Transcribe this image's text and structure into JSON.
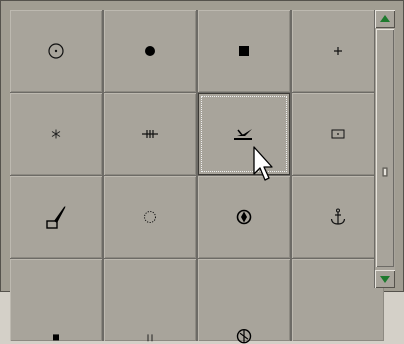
{
  "window": {
    "title": ""
  },
  "symbol_grid": {
    "selected_index": 6,
    "cells": [
      {
        "icon": "circle-dot-icon"
      },
      {
        "icon": "filled-circle-icon"
      },
      {
        "icon": "filled-square-icon"
      },
      {
        "icon": "plus-icon"
      },
      {
        "icon": "asterisk-icon"
      },
      {
        "icon": "railway-track-icon"
      },
      {
        "icon": "plane-wreck-icon"
      },
      {
        "icon": "dotted-rectangle-icon"
      },
      {
        "icon": "paintbrush-icon"
      },
      {
        "icon": "dotted-circle-icon"
      },
      {
        "icon": "circle-marker-icon"
      },
      {
        "icon": "anchor-icon"
      },
      {
        "icon": "partial-icon-a"
      },
      {
        "icon": "partial-icon-b"
      },
      {
        "icon": "partial-icon-c"
      },
      {
        "icon": "empty"
      }
    ]
  },
  "scrollbar": {
    "up_icon": "scroll-up-arrow-icon",
    "down_icon": "scroll-down-arrow-icon"
  },
  "colors": {
    "cell_bg": "#a8a49b",
    "frame_bg": "#a19d92",
    "arrow_green": "#1e7a2e"
  }
}
